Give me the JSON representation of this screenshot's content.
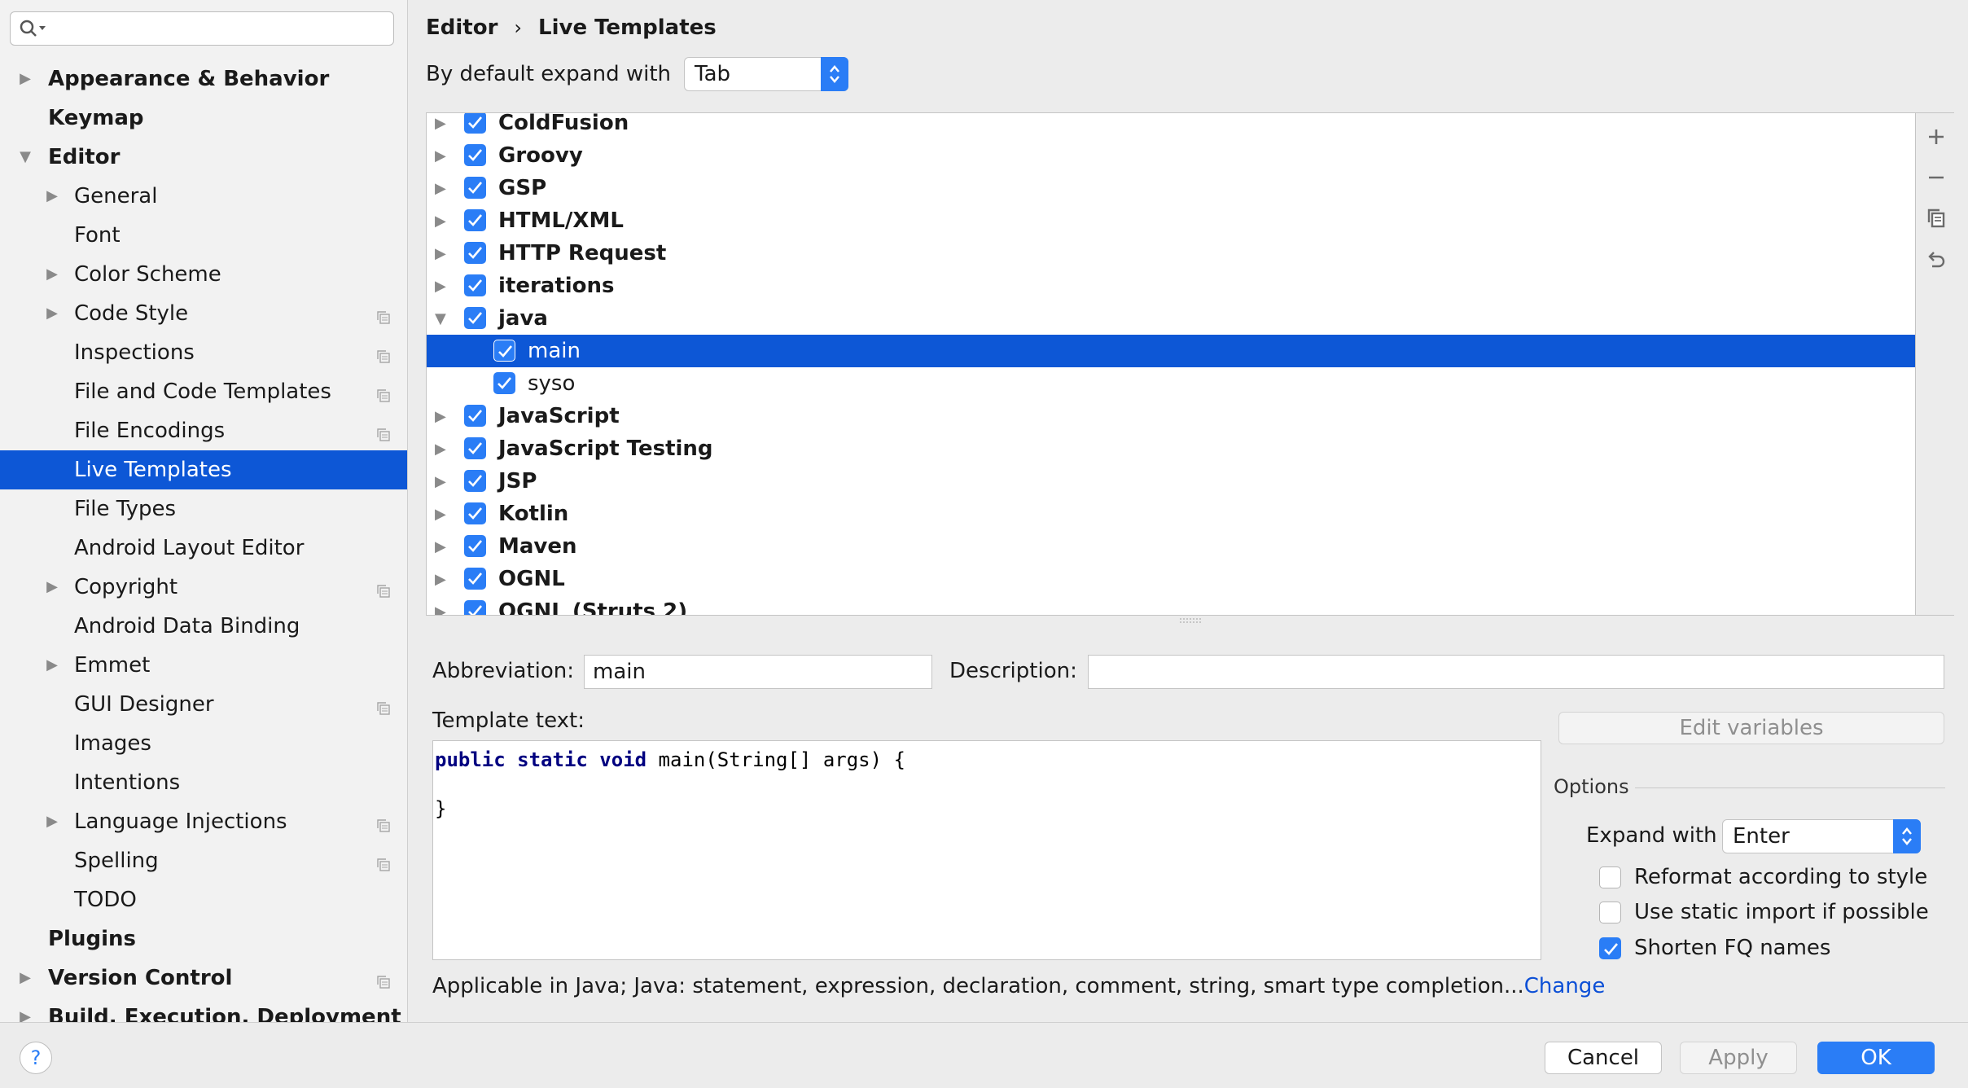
{
  "search": {
    "placeholder": "",
    "value": ""
  },
  "sidebar": {
    "items": [
      {
        "label": "Appearance & Behavior",
        "level": 0,
        "bold": true,
        "arrow": "right",
        "copy": false
      },
      {
        "label": "Keymap",
        "level": 0,
        "bold": true,
        "arrow": "none",
        "copy": false
      },
      {
        "label": "Editor",
        "level": 0,
        "bold": true,
        "arrow": "down",
        "copy": false
      },
      {
        "label": "General",
        "level": 1,
        "bold": false,
        "arrow": "right",
        "copy": false
      },
      {
        "label": "Font",
        "level": 1,
        "bold": false,
        "arrow": "none",
        "copy": false
      },
      {
        "label": "Color Scheme",
        "level": 1,
        "bold": false,
        "arrow": "right",
        "copy": false
      },
      {
        "label": "Code Style",
        "level": 1,
        "bold": false,
        "arrow": "right",
        "copy": true
      },
      {
        "label": "Inspections",
        "level": 1,
        "bold": false,
        "arrow": "none",
        "copy": true
      },
      {
        "label": "File and Code Templates",
        "level": 1,
        "bold": false,
        "arrow": "none",
        "copy": true
      },
      {
        "label": "File Encodings",
        "level": 1,
        "bold": false,
        "arrow": "none",
        "copy": true
      },
      {
        "label": "Live Templates",
        "level": 1,
        "bold": false,
        "arrow": "none",
        "copy": false,
        "selected": true
      },
      {
        "label": "File Types",
        "level": 1,
        "bold": false,
        "arrow": "none",
        "copy": false
      },
      {
        "label": "Android Layout Editor",
        "level": 1,
        "bold": false,
        "arrow": "none",
        "copy": false
      },
      {
        "label": "Copyright",
        "level": 1,
        "bold": false,
        "arrow": "right",
        "copy": true
      },
      {
        "label": "Android Data Binding",
        "level": 1,
        "bold": false,
        "arrow": "none",
        "copy": false
      },
      {
        "label": "Emmet",
        "level": 1,
        "bold": false,
        "arrow": "right",
        "copy": false
      },
      {
        "label": "GUI Designer",
        "level": 1,
        "bold": false,
        "arrow": "none",
        "copy": true
      },
      {
        "label": "Images",
        "level": 1,
        "bold": false,
        "arrow": "none",
        "copy": false
      },
      {
        "label": "Intentions",
        "level": 1,
        "bold": false,
        "arrow": "none",
        "copy": false
      },
      {
        "label": "Language Injections",
        "level": 1,
        "bold": false,
        "arrow": "right",
        "copy": true
      },
      {
        "label": "Spelling",
        "level": 1,
        "bold": false,
        "arrow": "none",
        "copy": true
      },
      {
        "label": "TODO",
        "level": 1,
        "bold": false,
        "arrow": "none",
        "copy": false
      },
      {
        "label": "Plugins",
        "level": 0,
        "bold": true,
        "arrow": "none",
        "copy": false
      },
      {
        "label": "Version Control",
        "level": 0,
        "bold": true,
        "arrow": "right",
        "copy": true
      },
      {
        "label": "Build, Execution, Deployment",
        "level": 0,
        "bold": true,
        "arrow": "right",
        "copy": false
      }
    ]
  },
  "breadcrumb": {
    "parent": "Editor",
    "separator": "›",
    "current": "Live Templates"
  },
  "expand_default": {
    "label": "By default expand with",
    "value": "Tab"
  },
  "templates": [
    {
      "label": "ColdFusion",
      "group": true,
      "expanded": false,
      "checked": true
    },
    {
      "label": "Groovy",
      "group": true,
      "expanded": false,
      "checked": true
    },
    {
      "label": "GSP",
      "group": true,
      "expanded": false,
      "checked": true
    },
    {
      "label": "HTML/XML",
      "group": true,
      "expanded": false,
      "checked": true
    },
    {
      "label": "HTTP Request",
      "group": true,
      "expanded": false,
      "checked": true
    },
    {
      "label": "iterations",
      "group": true,
      "expanded": false,
      "checked": true
    },
    {
      "label": "java",
      "group": true,
      "expanded": true,
      "checked": true
    },
    {
      "label": "main",
      "group": false,
      "checked": true,
      "selected": true
    },
    {
      "label": "syso",
      "group": false,
      "checked": true
    },
    {
      "label": "JavaScript",
      "group": true,
      "expanded": false,
      "checked": true
    },
    {
      "label": "JavaScript Testing",
      "group": true,
      "expanded": false,
      "checked": true
    },
    {
      "label": "JSP",
      "group": true,
      "expanded": false,
      "checked": true
    },
    {
      "label": "Kotlin",
      "group": true,
      "expanded": false,
      "checked": true
    },
    {
      "label": "Maven",
      "group": true,
      "expanded": false,
      "checked": true
    },
    {
      "label": "OGNL",
      "group": true,
      "expanded": false,
      "checked": true
    },
    {
      "label": "OGNL (Struts 2)",
      "group": true,
      "expanded": false,
      "checked": true
    }
  ],
  "toolbar_icons": [
    "plus-icon",
    "minus-icon",
    "copy-icon",
    "undo-icon"
  ],
  "form": {
    "abbreviation_label": "Abbreviation:",
    "abbreviation_value": "main",
    "description_label": "Description:",
    "description_value": "",
    "template_text_label": "Template text:",
    "code_line1_kw": "public static void",
    "code_line1_rest": " main(String[] args) {",
    "code_line2": "",
    "code_line3": "}",
    "edit_variables": "Edit variables",
    "options_title": "Options",
    "expand_with_label": "Expand with",
    "expand_with_value": "Enter",
    "reformat_label": "Reformat according to style",
    "reformat_checked": false,
    "static_import_label": "Use static import if possible",
    "static_import_checked": false,
    "shorten_fq_label": "Shorten FQ names",
    "shorten_fq_checked": true,
    "applicable_text": "Applicable in Java; Java: statement, expression, declaration, comment, string, smart type completion...",
    "applicable_link": "Change"
  },
  "footer": {
    "help": "?",
    "cancel": "Cancel",
    "apply": "Apply",
    "ok": "OK"
  },
  "colors": {
    "accent": "#2a7df6",
    "selection": "#0d57d6",
    "link": "#0c4fd6"
  }
}
